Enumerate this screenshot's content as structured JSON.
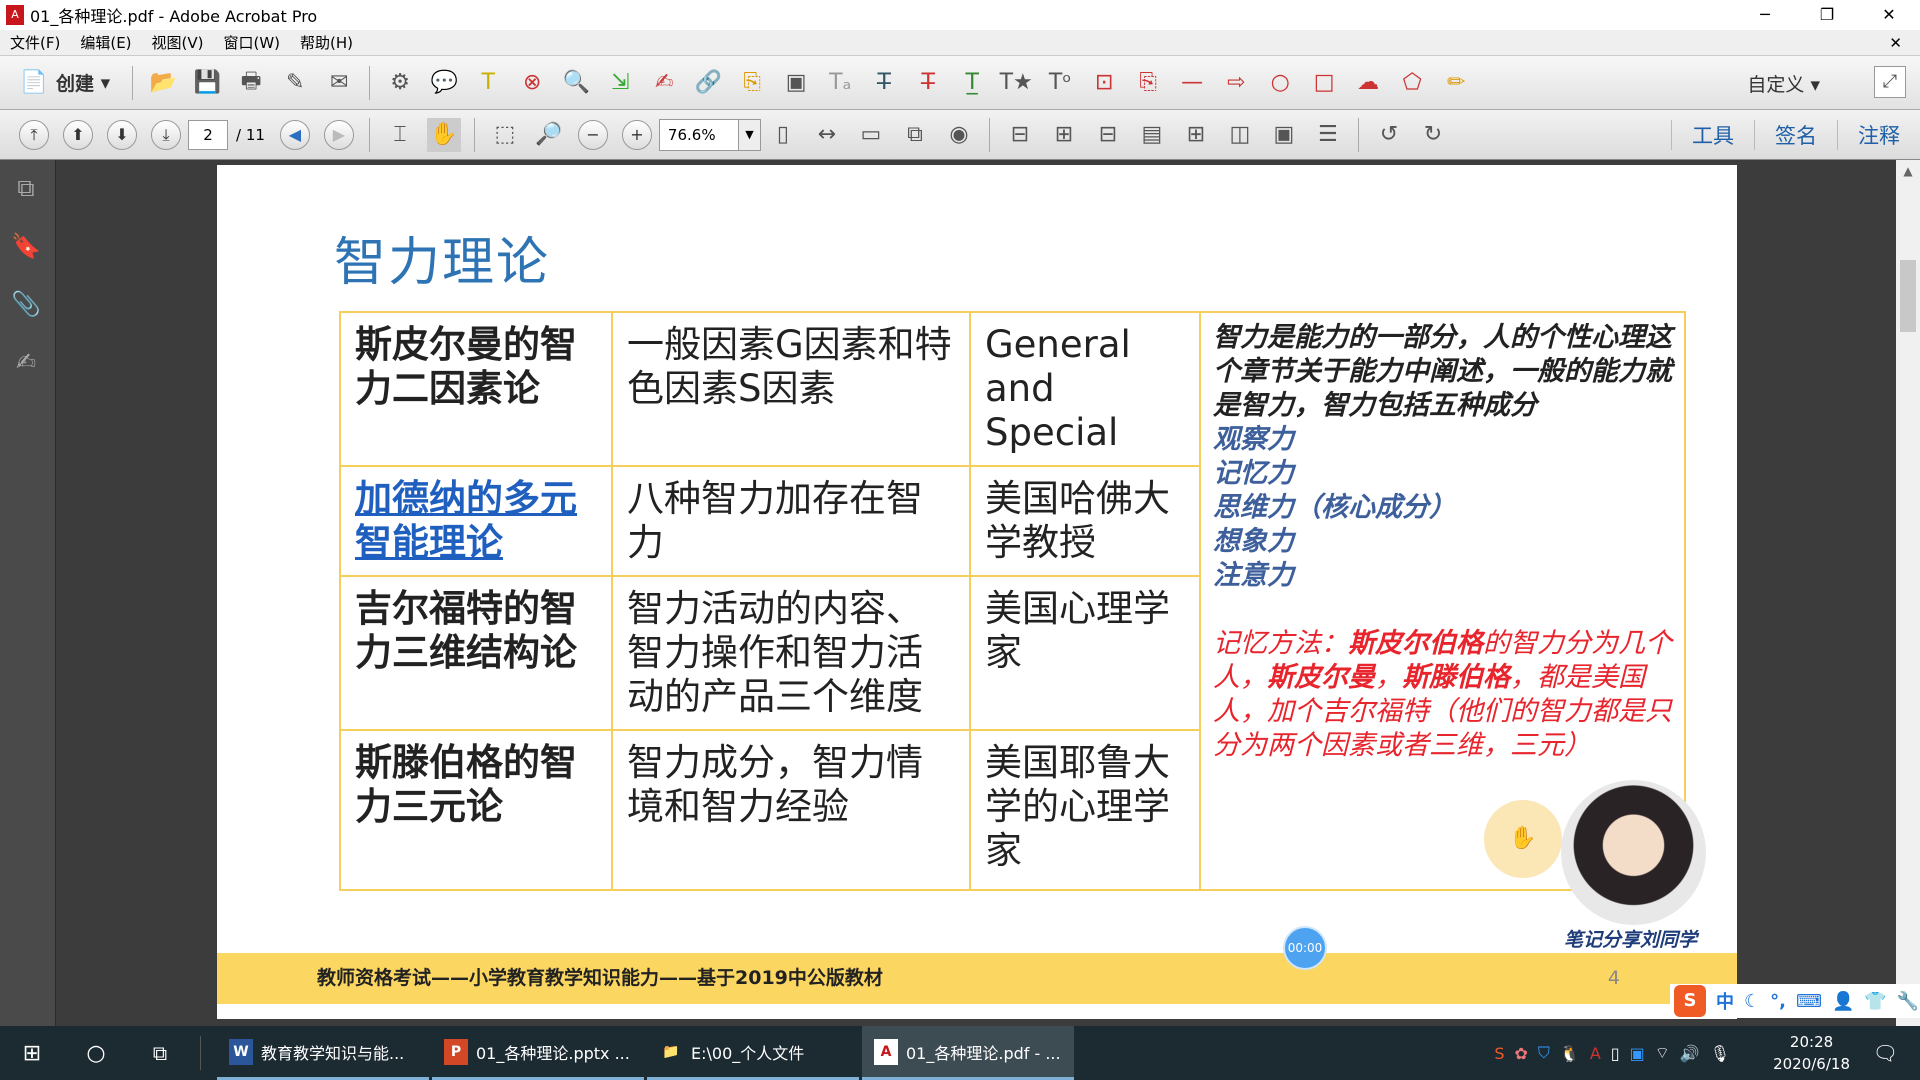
{
  "window": {
    "title": "01_各种理论.pdf - Adobe Acrobat Pro",
    "minimize": "─",
    "restore": "❐",
    "close": "✕"
  },
  "menu": [
    "文件(F)",
    "编辑(E)",
    "视图(V)",
    "窗口(W)",
    "帮助(H)"
  ],
  "menu_close": "✕",
  "toolbar": {
    "create_label": "创建",
    "custom_label": "自定义 ▾"
  },
  "nav": {
    "current_page": "2",
    "total_pages": "/ 11",
    "zoom": "76.6%"
  },
  "tabs": [
    "工具",
    "签名",
    "注释"
  ],
  "slide": {
    "title": "智力理论",
    "rows": [
      {
        "theory": "斯皮尔曼的智力二因素论",
        "content": "一般因素G因素和特色因素S因素",
        "note": "General and Special"
      },
      {
        "theory": "加德纳的多元智能理论",
        "content": "八种智力加存在智力",
        "note": "美国哈佛大学教授"
      },
      {
        "theory": "吉尔福特的智力三维结构论",
        "content": "智力活动的内容、智力操作和智力活动的产品三个维度",
        "note": "美国心理学家"
      },
      {
        "theory": "斯滕伯格的智力三元论",
        "content": "智力成分，智力情境和智力经验",
        "note": "美国耶鲁大学的心理学家"
      }
    ],
    "side_intro": "智力是能力的一部分，人的个性心理这个章节关于能力中阐述，一般的能力就是智力，智力包括五种成分",
    "components": [
      "观察力",
      "记忆力",
      "思维力（核心成分）",
      "想象力",
      "注意力"
    ],
    "memory_tip": {
      "prefix": "记忆方法：",
      "b1": "斯皮尔伯格",
      "t1": "的智力分为几个人，",
      "b2": "斯皮尔曼",
      "t2": "，",
      "b3": "斯滕伯格",
      "t3": "，都是美国人，加个吉尔福特（他们的智力都是只分为两个因素或者三维，三元）"
    },
    "footer": "教师资格考试——小学教育教学知识能力——基于2019中公版教材",
    "page_number": "4",
    "signature": "笔记分享刘同学",
    "timer": "00:00"
  },
  "colors": {
    "accent": "#2e74b5",
    "table_border": "#f6cf5a",
    "footer_band": "#fbd661",
    "tip_red": "#e8252d",
    "component_blue": "#3d5f9b"
  },
  "taskbar": {
    "items": [
      {
        "label": "教育教学知识与能...",
        "icon": "W"
      },
      {
        "label": "01_各种理论.pptx ...",
        "icon": "P"
      },
      {
        "label": "E:\\00_个人文件",
        "icon": "📁"
      },
      {
        "label": "01_各种理论.pdf - ...",
        "icon": "A"
      }
    ],
    "time": "20:28",
    "date": "2020/6/18"
  },
  "ime": {
    "lang": "中"
  }
}
